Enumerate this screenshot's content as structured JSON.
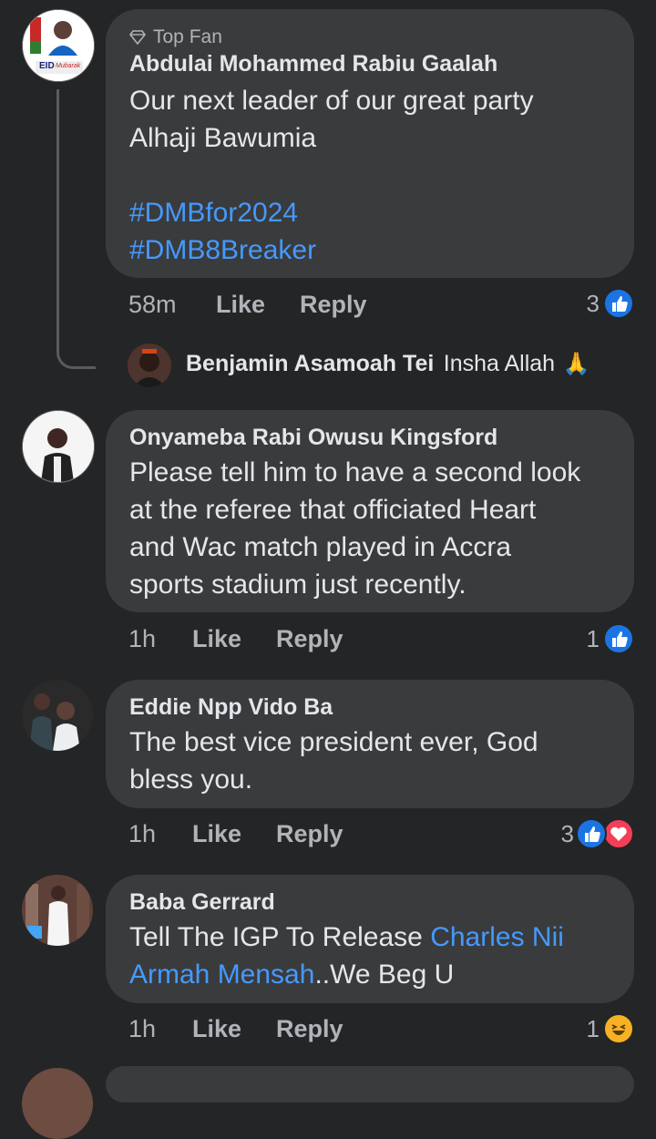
{
  "comments": [
    {
      "badge": "Top Fan",
      "author": "Abdulai Mohammed Rabiu Gaalah",
      "text_lines": [
        "Our next leader of our great party",
        "Alhaji Bawumia"
      ],
      "hashtags": [
        "#DMBfor2024",
        "#DMB8Breaker"
      ],
      "time": "58m",
      "like": "Like",
      "reply": "Reply",
      "reaction_count": "3",
      "reactions": [
        "like-icon"
      ],
      "avatar_text": {
        "top": "EID",
        "bottom": "Mubarak"
      }
    },
    {
      "author": "Onyameba Rabi Owusu Kingsford",
      "text_lines": [
        "Please tell him to have a second look",
        "at the referee that officiated Heart",
        "and Wac match played in Accra",
        "sports stadium just recently."
      ],
      "time": "1h",
      "like": "Like",
      "reply": "Reply",
      "reaction_count": "1",
      "reactions": [
        "like-icon"
      ]
    },
    {
      "author": "Eddie Npp Vido Ba",
      "text_lines": [
        "The best vice president ever, God",
        "bless you."
      ],
      "time": "1h",
      "like": "Like",
      "reply": "Reply",
      "reaction_count": "3",
      "reactions": [
        "like-icon",
        "love-icon"
      ]
    },
    {
      "author": "Baba Gerrard",
      "text_line1_pre": "Tell The IGP To Release ",
      "text_line1_link": "Charles Nii",
      "text_line2_link": "Armah Mensah",
      "text_line2_post": "..We Beg U",
      "time": "1h",
      "like": "Like",
      "reply": "Reply",
      "reaction_count": "1",
      "reactions": [
        "haha-icon"
      ]
    }
  ],
  "reply_preview": {
    "author": "Benjamin Asamoah Tei",
    "text": "Insha Allah",
    "emoji": "🙏"
  },
  "colors": {
    "background": "#242526",
    "bubble": "#3a3b3c",
    "link": "#4599ff",
    "like": "#1b74e4",
    "love": "#f33e58",
    "haha": "#f7b125"
  }
}
